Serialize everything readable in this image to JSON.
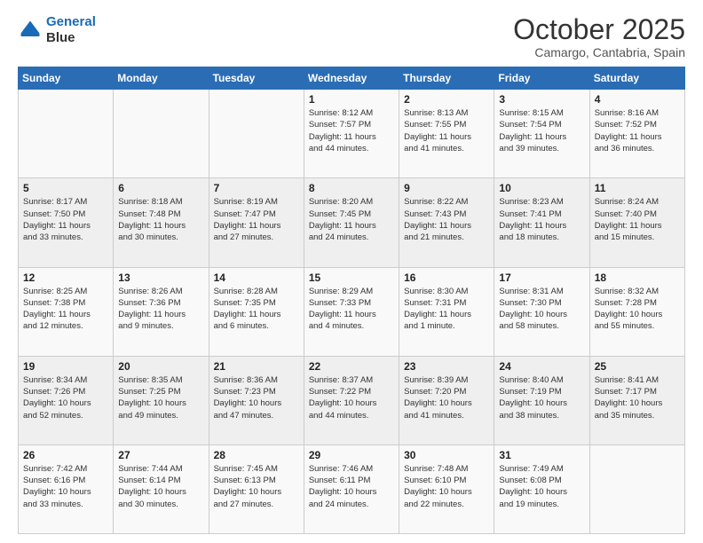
{
  "logo": {
    "line1": "General",
    "line2": "Blue"
  },
  "header": {
    "month": "October 2025",
    "location": "Camargo, Cantabria, Spain"
  },
  "days_of_week": [
    "Sunday",
    "Monday",
    "Tuesday",
    "Wednesday",
    "Thursday",
    "Friday",
    "Saturday"
  ],
  "weeks": [
    [
      {
        "day": "",
        "info": ""
      },
      {
        "day": "",
        "info": ""
      },
      {
        "day": "",
        "info": ""
      },
      {
        "day": "1",
        "info": "Sunrise: 8:12 AM\nSunset: 7:57 PM\nDaylight: 11 hours\nand 44 minutes."
      },
      {
        "day": "2",
        "info": "Sunrise: 8:13 AM\nSunset: 7:55 PM\nDaylight: 11 hours\nand 41 minutes."
      },
      {
        "day": "3",
        "info": "Sunrise: 8:15 AM\nSunset: 7:54 PM\nDaylight: 11 hours\nand 39 minutes."
      },
      {
        "day": "4",
        "info": "Sunrise: 8:16 AM\nSunset: 7:52 PM\nDaylight: 11 hours\nand 36 minutes."
      }
    ],
    [
      {
        "day": "5",
        "info": "Sunrise: 8:17 AM\nSunset: 7:50 PM\nDaylight: 11 hours\nand 33 minutes."
      },
      {
        "day": "6",
        "info": "Sunrise: 8:18 AM\nSunset: 7:48 PM\nDaylight: 11 hours\nand 30 minutes."
      },
      {
        "day": "7",
        "info": "Sunrise: 8:19 AM\nSunset: 7:47 PM\nDaylight: 11 hours\nand 27 minutes."
      },
      {
        "day": "8",
        "info": "Sunrise: 8:20 AM\nSunset: 7:45 PM\nDaylight: 11 hours\nand 24 minutes."
      },
      {
        "day": "9",
        "info": "Sunrise: 8:22 AM\nSunset: 7:43 PM\nDaylight: 11 hours\nand 21 minutes."
      },
      {
        "day": "10",
        "info": "Sunrise: 8:23 AM\nSunset: 7:41 PM\nDaylight: 11 hours\nand 18 minutes."
      },
      {
        "day": "11",
        "info": "Sunrise: 8:24 AM\nSunset: 7:40 PM\nDaylight: 11 hours\nand 15 minutes."
      }
    ],
    [
      {
        "day": "12",
        "info": "Sunrise: 8:25 AM\nSunset: 7:38 PM\nDaylight: 11 hours\nand 12 minutes."
      },
      {
        "day": "13",
        "info": "Sunrise: 8:26 AM\nSunset: 7:36 PM\nDaylight: 11 hours\nand 9 minutes."
      },
      {
        "day": "14",
        "info": "Sunrise: 8:28 AM\nSunset: 7:35 PM\nDaylight: 11 hours\nand 6 minutes."
      },
      {
        "day": "15",
        "info": "Sunrise: 8:29 AM\nSunset: 7:33 PM\nDaylight: 11 hours\nand 4 minutes."
      },
      {
        "day": "16",
        "info": "Sunrise: 8:30 AM\nSunset: 7:31 PM\nDaylight: 11 hours\nand 1 minute."
      },
      {
        "day": "17",
        "info": "Sunrise: 8:31 AM\nSunset: 7:30 PM\nDaylight: 10 hours\nand 58 minutes."
      },
      {
        "day": "18",
        "info": "Sunrise: 8:32 AM\nSunset: 7:28 PM\nDaylight: 10 hours\nand 55 minutes."
      }
    ],
    [
      {
        "day": "19",
        "info": "Sunrise: 8:34 AM\nSunset: 7:26 PM\nDaylight: 10 hours\nand 52 minutes."
      },
      {
        "day": "20",
        "info": "Sunrise: 8:35 AM\nSunset: 7:25 PM\nDaylight: 10 hours\nand 49 minutes."
      },
      {
        "day": "21",
        "info": "Sunrise: 8:36 AM\nSunset: 7:23 PM\nDaylight: 10 hours\nand 47 minutes."
      },
      {
        "day": "22",
        "info": "Sunrise: 8:37 AM\nSunset: 7:22 PM\nDaylight: 10 hours\nand 44 minutes."
      },
      {
        "day": "23",
        "info": "Sunrise: 8:39 AM\nSunset: 7:20 PM\nDaylight: 10 hours\nand 41 minutes."
      },
      {
        "day": "24",
        "info": "Sunrise: 8:40 AM\nSunset: 7:19 PM\nDaylight: 10 hours\nand 38 minutes."
      },
      {
        "day": "25",
        "info": "Sunrise: 8:41 AM\nSunset: 7:17 PM\nDaylight: 10 hours\nand 35 minutes."
      }
    ],
    [
      {
        "day": "26",
        "info": "Sunrise: 7:42 AM\nSunset: 6:16 PM\nDaylight: 10 hours\nand 33 minutes."
      },
      {
        "day": "27",
        "info": "Sunrise: 7:44 AM\nSunset: 6:14 PM\nDaylight: 10 hours\nand 30 minutes."
      },
      {
        "day": "28",
        "info": "Sunrise: 7:45 AM\nSunset: 6:13 PM\nDaylight: 10 hours\nand 27 minutes."
      },
      {
        "day": "29",
        "info": "Sunrise: 7:46 AM\nSunset: 6:11 PM\nDaylight: 10 hours\nand 24 minutes."
      },
      {
        "day": "30",
        "info": "Sunrise: 7:48 AM\nSunset: 6:10 PM\nDaylight: 10 hours\nand 22 minutes."
      },
      {
        "day": "31",
        "info": "Sunrise: 7:49 AM\nSunset: 6:08 PM\nDaylight: 10 hours\nand 19 minutes."
      },
      {
        "day": "",
        "info": ""
      }
    ]
  ]
}
